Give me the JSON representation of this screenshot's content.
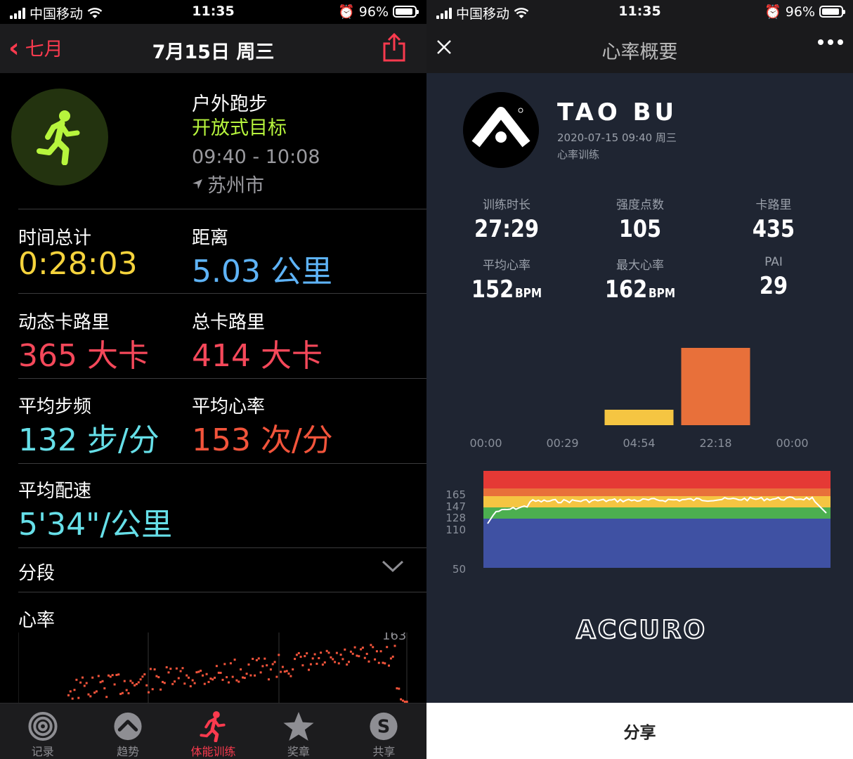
{
  "left": {
    "status": {
      "carrier": "中国移动",
      "time": "11:35",
      "battery": "96%"
    },
    "nav": {
      "back_label": "七月",
      "title": "7月15日 周三"
    },
    "workout": {
      "type": "户外跑步",
      "goal": "开放式目标",
      "time_range": "09:40 - 10:08",
      "location": "苏州市"
    },
    "metrics": [
      {
        "label": "时间总计",
        "value": "0:28:03"
      },
      {
        "label": "距离",
        "value": "5.03 公里"
      },
      {
        "label": "动态卡路里",
        "value": "365 大卡"
      },
      {
        "label": "总卡路里",
        "value": "414 大卡"
      },
      {
        "label": "平均步频",
        "value": "132 步/分"
      },
      {
        "label": "平均心率",
        "value": "153 次/分"
      },
      {
        "label": "平均配速",
        "value": "5'34\"/公里"
      }
    ],
    "splits_label": "分段",
    "hr_label": "心率",
    "hr_max_label": "163",
    "tabs": [
      {
        "label": "记录",
        "icon": "rings-icon"
      },
      {
        "label": "趋势",
        "icon": "trends-icon"
      },
      {
        "label": "体能训练",
        "icon": "runner-icon"
      },
      {
        "label": "奖章",
        "icon": "award-icon"
      },
      {
        "label": "共享",
        "icon": "sharing-icon"
      }
    ],
    "colors": {
      "accent": "#fa3a4e",
      "goal": "#b7f53d",
      "time": "#f5d33c",
      "distance": "#5eb3f7",
      "calories": "#f5485a",
      "cadence": "#66dfe8",
      "heart": "#f2543b"
    }
  },
  "right": {
    "status": {
      "carrier": "中国移动",
      "time": "11:35",
      "battery": "96%"
    },
    "nav": {
      "title": "心率概要"
    },
    "user": {
      "name": "TAO BU",
      "datetime": "2020-07-15 09:40 周三",
      "type": "心率训练"
    },
    "stats": [
      {
        "label": "训练时长",
        "value": "27:29",
        "unit": ""
      },
      {
        "label": "强度点数",
        "value": "105",
        "unit": ""
      },
      {
        "label": "卡路里",
        "value": "435",
        "unit": ""
      },
      {
        "label": "平均心率",
        "value": "152",
        "unit": "BPM"
      },
      {
        "label": "最大心率",
        "value": "162",
        "unit": "BPM"
      },
      {
        "label": "PAI",
        "value": "29",
        "unit": ""
      }
    ],
    "zone_chart": {
      "type": "bar",
      "categories": [
        "00:00",
        "00:29",
        "04:54",
        "22:18",
        "00:00"
      ],
      "values": [
        0,
        0,
        0.2,
        1.0,
        0
      ],
      "colors": [
        "#3f51a3",
        "#4caf50",
        "#f5c542",
        "#e8703a",
        "#e53935"
      ]
    },
    "hr_band": {
      "ticks": [
        "165",
        "147",
        "128",
        "110",
        "50"
      ],
      "zones": [
        "#e53935",
        "#e8703a",
        "#f5c542",
        "#4caf50",
        "#3f51a3"
      ]
    },
    "brand": "ACCURO",
    "share_label": "分享"
  }
}
